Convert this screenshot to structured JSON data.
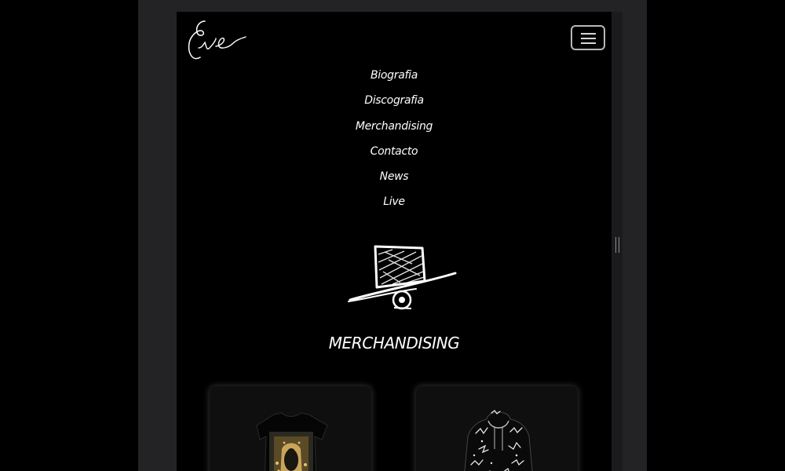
{
  "brand": {
    "logo_text": "Eve"
  },
  "menu_button": {
    "icon": "hamburger-icon"
  },
  "nav": {
    "items": [
      {
        "label": "Biografia"
      },
      {
        "label": "Discografia"
      },
      {
        "label": "Merchandising"
      },
      {
        "label": "Contacto"
      },
      {
        "label": "News"
      },
      {
        "label": "Live"
      }
    ]
  },
  "section": {
    "title": "MERCHANDISING",
    "icon": "top-hat-icon"
  },
  "products": [
    {
      "image": "tshirt-product-image"
    },
    {
      "image": "hoodie-product-image"
    }
  ],
  "colors": {
    "page_bg": "#000000",
    "frame": "#232325",
    "text": "#ffffff",
    "card_bg": "#0f0f10"
  }
}
